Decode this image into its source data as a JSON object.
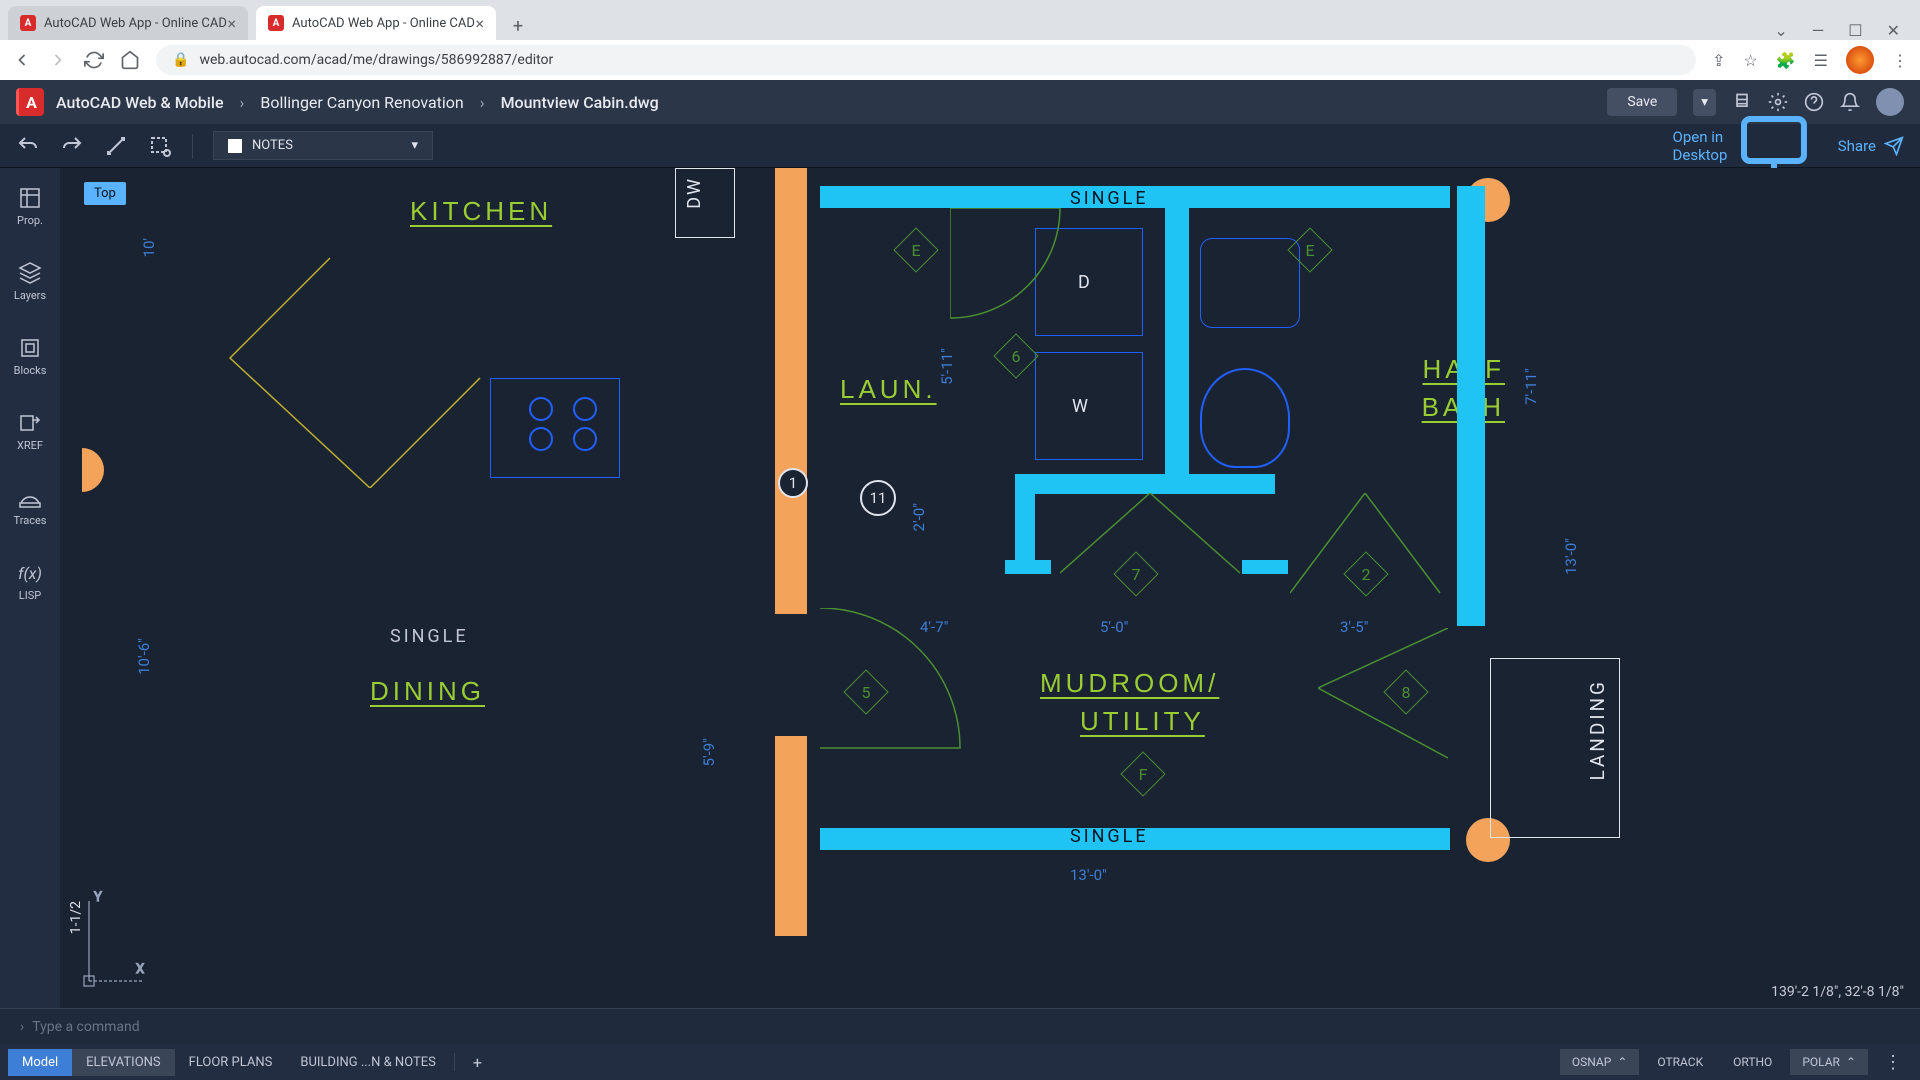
{
  "browser": {
    "tabs": [
      {
        "title": "AutoCAD Web App - Online CAD"
      },
      {
        "title": "AutoCAD Web App - Online CAD"
      }
    ],
    "url": "web.autocad.com/acad/me/drawings/586992887/editor"
  },
  "header": {
    "brand": "AutoCAD Web & Mobile",
    "crumb1": "Bollinger Canyon Renovation",
    "crumb2": "Mountview Cabin.dwg",
    "save_label": "Save"
  },
  "toolbar": {
    "layer_name": "NOTES",
    "open_desktop": "Open in Desktop",
    "share": "Share"
  },
  "sidebar": {
    "items": [
      {
        "label": "Prop."
      },
      {
        "label": "Layers"
      },
      {
        "label": "Blocks"
      },
      {
        "label": "XREF"
      },
      {
        "label": "Traces"
      },
      {
        "label": "LISP"
      }
    ]
  },
  "canvas": {
    "viewcube": "Top",
    "rooms": {
      "kitchen": "KITCHEN",
      "laun": "LAUN.",
      "half_bath_1": "HALF",
      "half_bath_2": "BATH",
      "mudroom_1": "MUDROOM/",
      "mudroom_2": "UTILITY",
      "dining": "DINING",
      "landing": "LANDING",
      "dw": "DW"
    },
    "single1": "SINGLE",
    "single2": "SINGLE",
    "single3": "SINGLE",
    "markers": {
      "m1": "1",
      "m11": "11",
      "d": "D",
      "w": "W"
    },
    "hex": {
      "e1": "E",
      "e2": "E",
      "h6": "6",
      "h5": "5",
      "h7": "7",
      "h2": "2",
      "h8": "8",
      "f": "F"
    },
    "dims": {
      "d1": "5'-11\"",
      "d2": "2'-0\"",
      "d3": "4'-7\"",
      "d4": "5'-0\"",
      "d5": "3'-5\"",
      "d6": "7'-11\"",
      "d7": "13'-0\"",
      "d8": "5'-9\"",
      "d9": "10'-6\"",
      "d10": "10'",
      "d11": "13'-0\"",
      "d12": "1-1/2"
    },
    "coords": "139'-2 1/8\", 32'-8 1/8\"",
    "axes": {
      "x": "X",
      "y": "Y"
    }
  },
  "cmdline": {
    "placeholder": "Type a command"
  },
  "layout_tabs": [
    {
      "label": "Model"
    },
    {
      "label": "ELEVATIONS"
    },
    {
      "label": "FLOOR PLANS"
    },
    {
      "label": "BUILDING ...N & NOTES"
    }
  ],
  "status": {
    "osnap": "OSNAP",
    "otrack": "OTRACK",
    "ortho": "ORTHO",
    "polar": "POLAR"
  }
}
